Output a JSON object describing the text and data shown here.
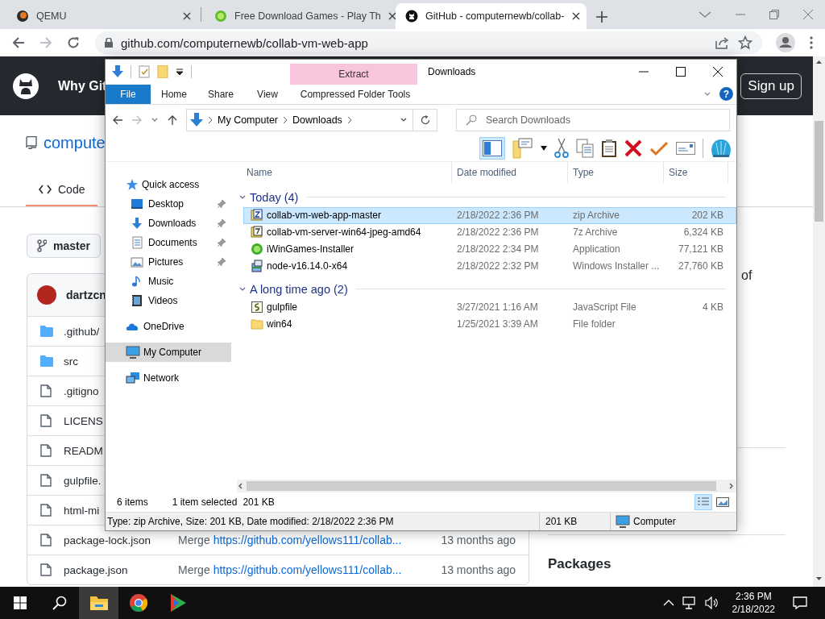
{
  "browser": {
    "tabs": [
      {
        "title": "QEMU",
        "kind": "qemu",
        "selected": false
      },
      {
        "title": "Free Download Games - Play Th",
        "kind": "games",
        "selected": false
      },
      {
        "title": "GitHub - computernewb/collab-",
        "kind": "github",
        "selected": true
      }
    ],
    "url": "github.com/computernewb/collab-vm-web-app"
  },
  "page": {
    "nav_link": "Why Git",
    "signup_button": "Sign up",
    "repo_name": "compute",
    "tab": "Code",
    "branch": "master",
    "commit_author": "dartzcn",
    "files": [
      {
        "name": ".github/",
        "kind": "folder"
      },
      {
        "name": "src",
        "kind": "folder"
      },
      {
        "name": ".gitigno",
        "kind": "file"
      },
      {
        "name": "LICENS",
        "kind": "file"
      },
      {
        "name": "READM",
        "kind": "file"
      },
      {
        "name": "gulpfile.",
        "kind": "file"
      },
      {
        "name": "html-mi",
        "kind": "file"
      },
      {
        "name": "package-lock.json",
        "kind": "file",
        "message": "Merge",
        "link": "https://github.com/yellows111/collab...",
        "age": "13 months ago"
      },
      {
        "name": "package.json",
        "kind": "file",
        "message": "Merge",
        "link": "https://github.com/yellows111/collab...",
        "age": "13 months ago"
      }
    ],
    "sidebar_text": "of",
    "sidebar_heading": "Packages"
  },
  "explorer": {
    "context_tab": "Extract",
    "title": "Downloads",
    "help_button": "?",
    "ribbon_tabs": [
      {
        "label": "File",
        "kind": "file"
      },
      {
        "label": "Home",
        "kind": "tab"
      },
      {
        "label": "Share",
        "kind": "tab"
      },
      {
        "label": "View",
        "kind": "tab"
      },
      {
        "label": "Compressed Folder Tools",
        "kind": "context"
      }
    ],
    "path": [
      "My Computer",
      "Downloads"
    ],
    "search_placeholder": "Search Downloads",
    "preview_pane_on": true,
    "nav": [
      {
        "label": "Quick access",
        "kind": "star",
        "selected": false,
        "children": [
          {
            "label": "Desktop",
            "kind": "desktop",
            "pinned": true,
            "selected": false
          },
          {
            "label": "Downloads",
            "kind": "downloads",
            "pinned": true,
            "selected": false
          },
          {
            "label": "Documents",
            "kind": "documents",
            "pinned": true,
            "selected": false
          },
          {
            "label": "Pictures",
            "kind": "pictures",
            "pinned": true,
            "selected": false
          },
          {
            "label": "Music",
            "kind": "music",
            "pinned": false,
            "selected": false
          },
          {
            "label": "Videos",
            "kind": "videos",
            "pinned": false,
            "selected": false
          }
        ]
      },
      {
        "label": "OneDrive",
        "kind": "cloud",
        "selected": false
      },
      {
        "label": "My Computer",
        "kind": "computer",
        "selected": true
      },
      {
        "label": "Network",
        "kind": "network",
        "selected": false
      }
    ],
    "columns": [
      "Name",
      "Date modified",
      "Type",
      "Size"
    ],
    "groups": [
      {
        "label": "Today (4)",
        "expanded": true,
        "files": [
          {
            "name": "collab-vm-web-app-master",
            "date": "2/18/2022 2:36 PM",
            "type": "zip Archive",
            "size": "202 KB",
            "kind": "zip",
            "selected": true
          },
          {
            "name": "collab-vm-server-win64-jpeg-amd64",
            "date": "2/18/2022 2:36 PM",
            "type": "7z Archive",
            "size": "6,324 KB",
            "kind": "sevenzip",
            "selected": false
          },
          {
            "name": "iWinGames-Installer",
            "date": "2/18/2022 2:34 PM",
            "type": "Application",
            "size": "77,121 KB",
            "kind": "app",
            "selected": false
          },
          {
            "name": "node-v16.14.0-x64",
            "date": "2/18/2022 2:32 PM",
            "type": "Windows Installer ...",
            "size": "27,760 KB",
            "kind": "msi",
            "selected": false
          }
        ]
      },
      {
        "label": "A long time ago (2)",
        "expanded": true,
        "files": [
          {
            "name": "gulpfile",
            "date": "3/27/2021 1:16 AM",
            "type": "JavaScript File",
            "size": "4 KB",
            "kind": "script",
            "selected": false
          },
          {
            "name": "win64",
            "date": "1/25/2021 3:39 AM",
            "type": "File folder",
            "kind": "folder",
            "selected": false
          }
        ]
      }
    ],
    "status": {
      "items": "6 items",
      "selection": "1 item selected",
      "selection_size": "201 KB"
    },
    "view_buttons": [
      {
        "kind": "details",
        "selected": true
      },
      {
        "kind": "large-icons",
        "selected": false
      }
    ],
    "details": {
      "summary": "Type: zip Archive, Size: 201 KB, Date modified: 2/18/2022 2:36 PM",
      "size": "201 KB",
      "location": "Computer"
    }
  },
  "taskbar": {
    "apps": [
      {
        "kind": "explorer",
        "selected": true
      },
      {
        "kind": "chrome",
        "selected": false
      },
      {
        "kind": "media",
        "selected": false
      }
    ],
    "time": "2:36 PM",
    "date": "2/18/2022"
  }
}
